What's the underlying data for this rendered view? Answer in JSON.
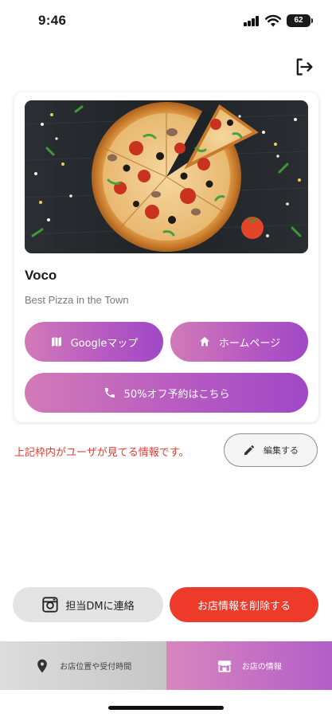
{
  "status_bar": {
    "time": "9:46",
    "battery": "62"
  },
  "store": {
    "name": "Voco",
    "description": "Best Pizza in the Town",
    "image": "pizza-photo"
  },
  "actions": {
    "map_label": "Googleマップ",
    "homepage_label": "ホームページ",
    "reserve_label": "50%オフ予約はこちら"
  },
  "note": "上記枠内がユーザが見てる情報です。",
  "edit_label": "編集する",
  "footer_actions": {
    "dm_label": "担当DMに連絡",
    "delete_label": "お店情報を削除する"
  },
  "nav": {
    "location_label": "お店位置や受付時間",
    "info_label": "お店の情報"
  },
  "colors": {
    "accent_gradient_start": "#d27ab7",
    "accent_gradient_end": "#a048c6",
    "danger": "#ee3a2a",
    "note_text": "#e33b2f"
  },
  "icons": {
    "logout": "logout-icon",
    "map": "map-icon",
    "home": "home-icon",
    "phone": "phone-icon",
    "edit": "pencil-icon",
    "instagram": "instagram-icon",
    "location": "location-pin-icon",
    "store": "storefront-icon"
  }
}
